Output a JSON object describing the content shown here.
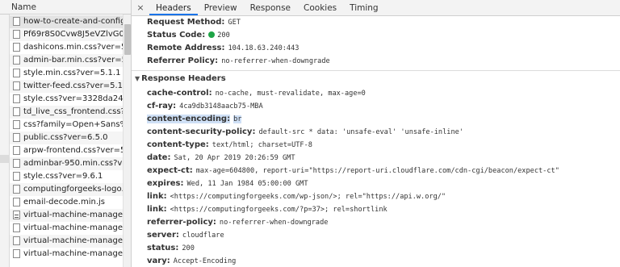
{
  "files_panel": {
    "header": "Name",
    "files": [
      {
        "name": "how-to-create-and-configu...",
        "selected": true
      },
      {
        "name": "Pf69r8S0Cvw8J5eVZlvG0A..."
      },
      {
        "name": "dashicons.min.css?ver=5..."
      },
      {
        "name": "admin-bar.min.css?ver=5..."
      },
      {
        "name": "style.min.css?ver=5.1.1"
      },
      {
        "name": "twitter-feed.css?ver=5.1.1"
      },
      {
        "name": "style.css?ver=3328da248..."
      },
      {
        "name": "td_live_css_frontend.css?v..."
      },
      {
        "name": "css?family=Open+Sans%..."
      },
      {
        "name": "public.css?ver=6.5.0"
      },
      {
        "name": "arpw-frontend.css?ver=5..."
      },
      {
        "name": "adminbar-950.min.css?ver..."
      },
      {
        "name": "style.css?ver=9.6.1"
      },
      {
        "name": "computingforgeeks-logo.p..."
      },
      {
        "name": "email-decode.min.js"
      },
      {
        "name": "virtual-machine-manager-..."
      },
      {
        "name": "virtual-machine-manager-..."
      },
      {
        "name": "virtual-machine-manager-..."
      },
      {
        "name": "virtual-machine-manager-i..."
      }
    ]
  },
  "tabs": {
    "close": "×",
    "items": [
      "Headers",
      "Preview",
      "Response",
      "Cookies",
      "Timing"
    ],
    "active": "Headers"
  },
  "general": {
    "request_method": {
      "key": "Request Method:",
      "value": "GET"
    },
    "status_code": {
      "key": "Status Code:",
      "value": "200",
      "status_color": "#1ea446"
    },
    "remote_address": {
      "key": "Remote Address:",
      "value": "104.18.63.240:443"
    },
    "referrer_policy": {
      "key": "Referrer Policy:",
      "value": "no-referrer-when-downgrade"
    }
  },
  "response_headers": {
    "title": "Response Headers",
    "items": [
      {
        "key": "cache-control:",
        "value": "no-cache, must-revalidate, max-age=0"
      },
      {
        "key": "cf-ray:",
        "value": "4ca9db3148aacb75-MBA"
      },
      {
        "key": "content-encoding:",
        "value": "br",
        "highlight": true
      },
      {
        "key": "content-security-policy:",
        "value": "default-src * data: 'unsafe-eval' 'unsafe-inline'"
      },
      {
        "key": "content-type:",
        "value": "text/html; charset=UTF-8"
      },
      {
        "key": "date:",
        "value": "Sat, 20 Apr 2019 20:26:59 GMT"
      },
      {
        "key": "expect-ct:",
        "value": "max-age=604800, report-uri=\"https://report-uri.cloudflare.com/cdn-cgi/beacon/expect-ct\""
      },
      {
        "key": "expires:",
        "value": "Wed, 11 Jan 1984 05:00:00 GMT"
      },
      {
        "key": "link:",
        "value": "<https://computingforgeeks.com/wp-json/>; rel=\"https://api.w.org/\""
      },
      {
        "key": "link:",
        "value": "<https://computingforgeeks.com/?p=37>; rel=shortlink"
      },
      {
        "key": "referrer-policy:",
        "value": "no-referrer-when-downgrade"
      },
      {
        "key": "server:",
        "value": "cloudflare"
      },
      {
        "key": "status:",
        "value": "200"
      },
      {
        "key": "vary:",
        "value": "Accept-Encoding"
      }
    ]
  }
}
